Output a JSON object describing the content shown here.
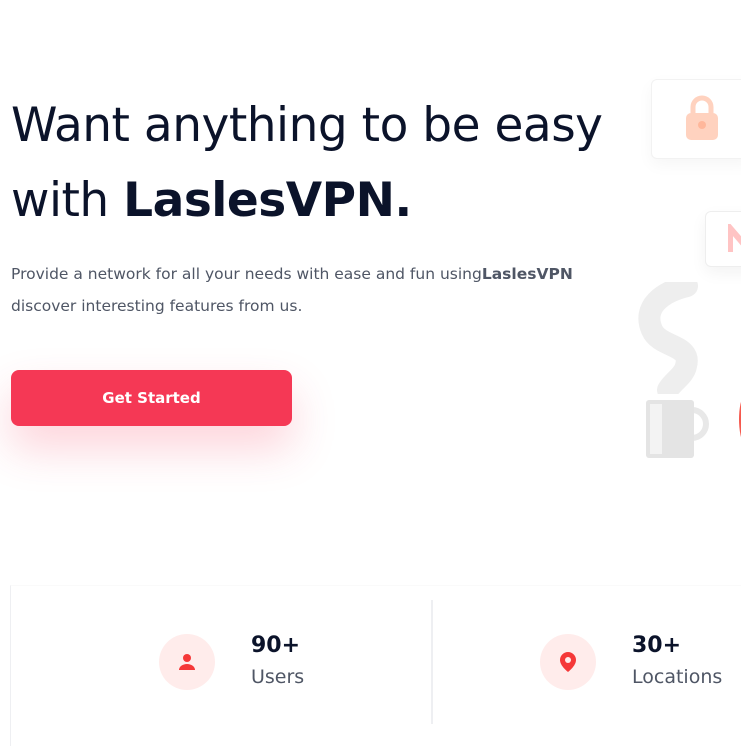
{
  "hero": {
    "title_line1": "Want anything to be easy",
    "title_line2_prefix": "with ",
    "title_brand": "LaslesVPN.",
    "description_prefix": "Provide a network for all your needs with ease and fun using",
    "description_brand": "LaslesVPN",
    "description_suffix": " discover interesting features from us.",
    "cta_label": "Get Started"
  },
  "illustration": {
    "icons": [
      "lock-icon",
      "mail-icon",
      "steam-icon",
      "mug-icon"
    ]
  },
  "stats": [
    {
      "value": "90+",
      "label": "Users",
      "icon": "user-icon"
    },
    {
      "value": "30+",
      "label": "Locations",
      "icon": "location-pin-icon"
    }
  ],
  "colors": {
    "accent": "#f53855",
    "heading": "#0b132a",
    "body_text": "#4f5665",
    "icon_bg": "#ffeceb"
  }
}
